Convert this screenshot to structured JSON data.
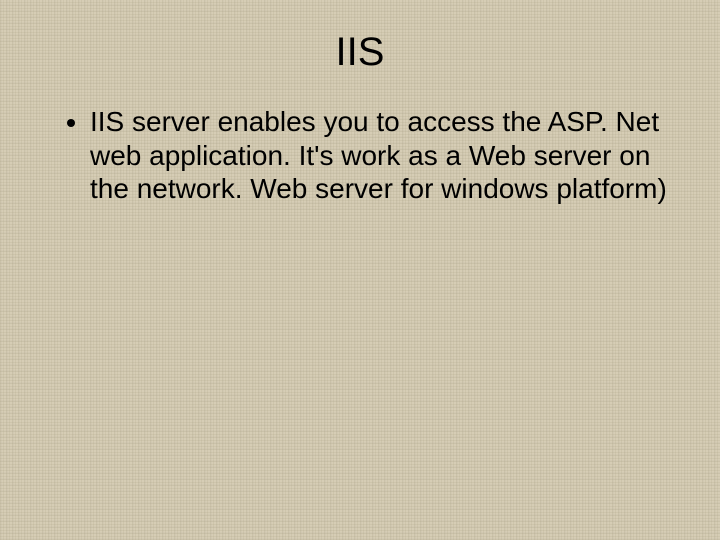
{
  "slide": {
    "title": "IIS",
    "bullets": [
      "IIS server enables you to access the ASP. Net web application. It's work as a Web server on the network. Web server for windows platform)"
    ]
  }
}
